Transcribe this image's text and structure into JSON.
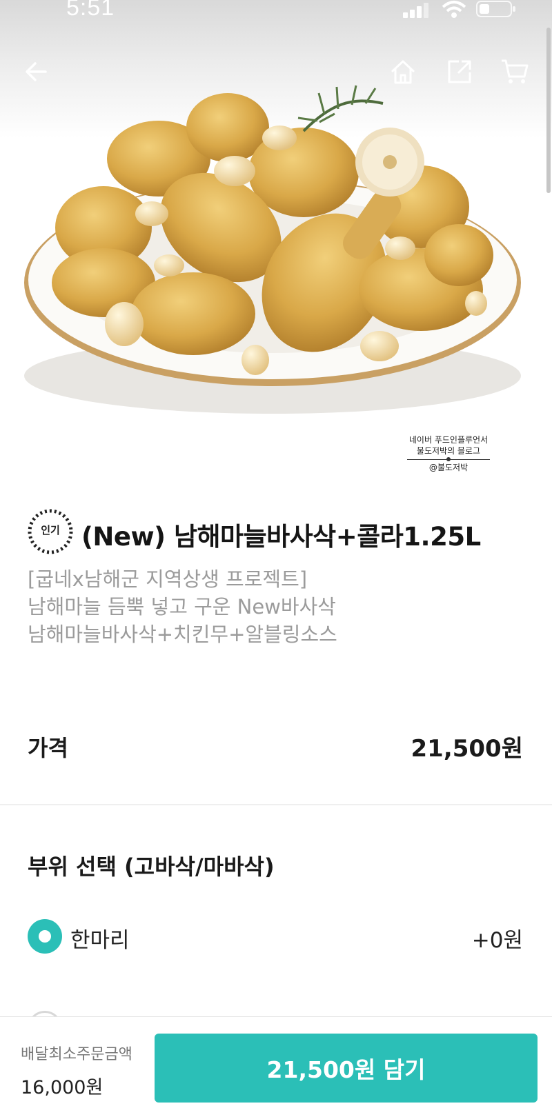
{
  "status_bar": {
    "time": "5:51"
  },
  "image_credit": {
    "line1": "네이버 푸드인플루언서",
    "line2": "불도저박의 블로그",
    "handle": "@불도저박"
  },
  "product": {
    "badge": "인기",
    "title": "(New) 남해마늘바사삭+콜라1.25L",
    "description": [
      "[굽네x남해군 지역상생 프로젝트]",
      "남해마늘 듬뿍 넣고 구운 New바사삭",
      "남해마늘바사삭+치킨무+알블링소스"
    ]
  },
  "price": {
    "label": "가격",
    "value": "21,500원"
  },
  "option_group": {
    "title": "부위 선택 (고바삭/마바삭)",
    "options": [
      {
        "label": "한마리",
        "price": "+0원",
        "selected": true
      }
    ]
  },
  "bottom_bar": {
    "min_order_label": "배달최소주문금액",
    "min_order_value": "16,000원",
    "cta_label": "21,500원 담기"
  },
  "colors": {
    "accent": "#2bbfb7"
  },
  "icons": [
    "back-arrow-icon",
    "home-icon",
    "share-icon",
    "cart-icon",
    "signal-icon",
    "wifi-icon",
    "battery-icon",
    "popular-badge-icon"
  ]
}
